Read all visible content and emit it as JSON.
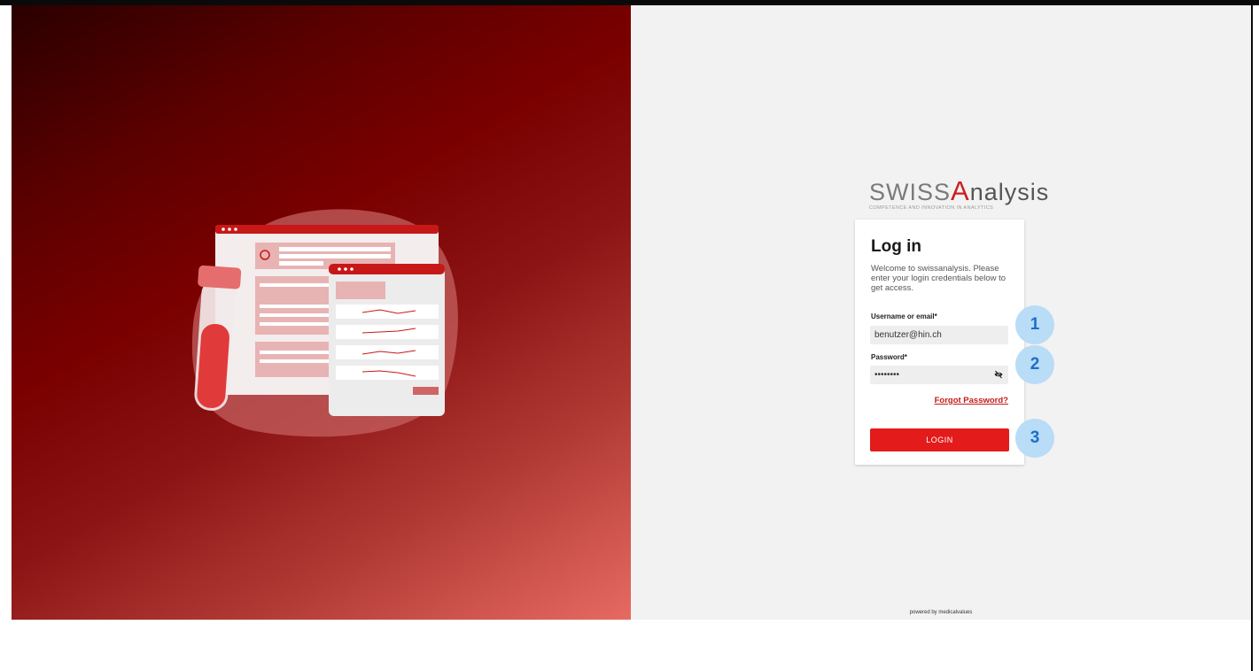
{
  "logo": {
    "brand": "swissAnalysis",
    "word_prefix": "SWISS",
    "word_a": "A",
    "word_rest": "nalysis",
    "tagline": "COMPETENCE AND INNOVATION IN ANALYTICS"
  },
  "login": {
    "title": "Log in",
    "description": "Welcome to swissanalysis. Please enter your login credentials below to get access.",
    "username_label": "Username or email*",
    "username_value": "benutzer@hin.ch",
    "password_label": "Password*",
    "password_value": "••••••••",
    "forgot_password": "Forgot Password?",
    "login_button": "LOGIN"
  },
  "steps": [
    "1",
    "2",
    "3"
  ],
  "footer": {
    "text": "powered by medicalvalues"
  },
  "icons": {
    "password_toggle": "eye-slash-icon"
  },
  "colors": {
    "accent": "#e31b1b",
    "step_badge_bg": "#b9dcf7",
    "step_badge_text": "#1b6fc8",
    "background": "#f2f2f2"
  }
}
